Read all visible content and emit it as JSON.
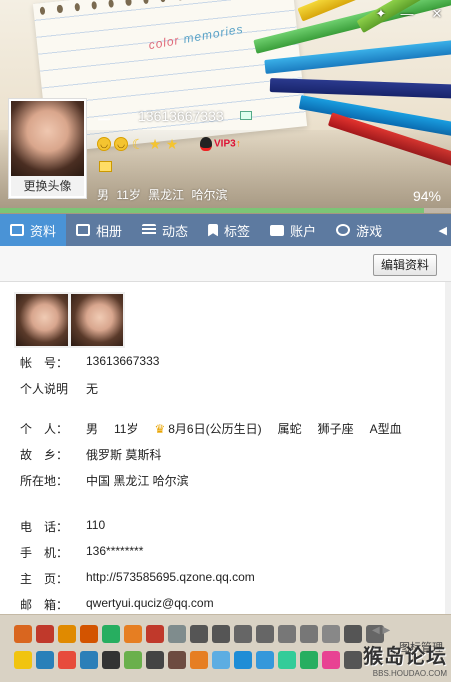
{
  "header": {
    "deco_text": [
      "color",
      "memories"
    ],
    "qq_number": "13613667333",
    "vip": "VIP3",
    "gender": "男",
    "age": "11岁",
    "location": "黑龙江 哈尔滨",
    "completeness": "94%",
    "completeness_value": 0.94,
    "avatar_change_label": "更换头像",
    "window_controls": [
      "skin-icon",
      "minimize-icon",
      "close-icon"
    ]
  },
  "tabs": [
    {
      "label": "资料",
      "icon": "profile-card-icon",
      "active": true
    },
    {
      "label": "相册",
      "icon": "album-icon"
    },
    {
      "label": "动态",
      "icon": "feed-icon"
    },
    {
      "label": "标签",
      "icon": "bookmark-icon"
    },
    {
      "label": "账户",
      "icon": "wallet-icon"
    },
    {
      "label": "游戏",
      "icon": "game-icon"
    }
  ],
  "toolbar": {
    "edit_label": "编辑资料"
  },
  "profile": {
    "account_label": "帐　号：",
    "account": "13613667333",
    "desc_label": "个人说明",
    "desc": "无",
    "personal_label": "个　人：",
    "gender": "男",
    "age": "11岁",
    "birthday": "8月6日(公历生日)",
    "zodiac": "属蛇",
    "constellation": "狮子座",
    "blood": "A型血",
    "hometown_label": "故　乡：",
    "hometown": "俄罗斯 莫斯科",
    "location_label": "所在地：",
    "location": "中国 黑龙江 哈尔滨",
    "phone_label": "电　话：",
    "phone": "110",
    "mobile_label": "手　机：",
    "mobile": "136********",
    "homepage_label": "主　页：",
    "homepage": "http://573585695.qzone.qq.com",
    "email_label": "邮　箱：",
    "email": "qwertyui.quciz@qq.com"
  },
  "bottom": {
    "manage_label": "图标管理",
    "watermark_big": "猴岛论坛",
    "watermark_small": "BBS.HOUDAO.COM",
    "row1": [
      "#d9661f",
      "#c0392b",
      "#e08a00",
      "#d35400",
      "#27ae60",
      "#e67e22",
      "#c0392b",
      "#7f8c8d",
      "#555",
      "#555",
      "#666",
      "#666",
      "#777",
      "#777",
      "#888",
      "#555",
      "#666"
    ],
    "row2": [
      "#f1c40f",
      "#2980b9",
      "#e74c3c",
      "#2c7fb8",
      "#333",
      "#6ab04c",
      "#444",
      "#6d4c41",
      "#e67e22",
      "#5dade2",
      "#1f8dd6",
      "#3498db",
      "#3c9",
      "#27ae60",
      "#e84393",
      "#555"
    ]
  }
}
